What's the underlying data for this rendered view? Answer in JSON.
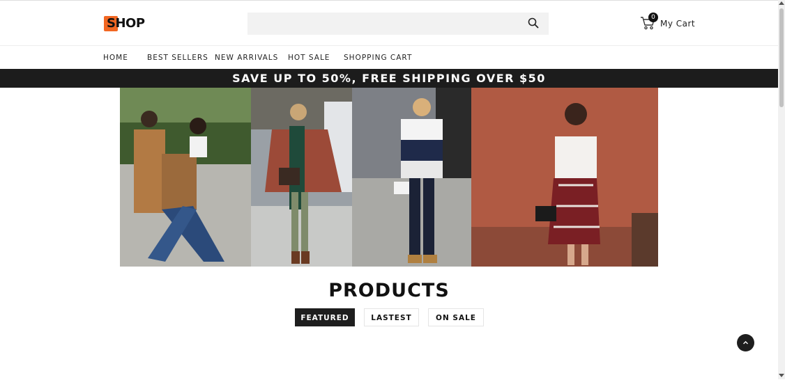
{
  "header": {
    "logo_text": "SHOP",
    "search": {
      "placeholder": "",
      "value": ""
    },
    "cart": {
      "count": "0",
      "label": "My Cart"
    }
  },
  "nav": {
    "items": [
      {
        "label": "HOME"
      },
      {
        "label": "BEST SELLERS"
      },
      {
        "label": "NEW ARRIVALS"
      },
      {
        "label": "HOT SALE"
      },
      {
        "label": "SHOPPING CART"
      }
    ]
  },
  "promo": {
    "text": "SAVE UP TO 50%, FREE SHIPPING OVER $50"
  },
  "products": {
    "title": "PRODUCTS",
    "tabs": [
      {
        "label": "FEATURED",
        "active": true
      },
      {
        "label": "LASTEST",
        "active": false
      },
      {
        "label": "ON SALE",
        "active": false
      }
    ]
  },
  "colors": {
    "brand_orange": "#f26722",
    "dark": "#1e1e1e",
    "search_bg": "#f2f2f2"
  }
}
